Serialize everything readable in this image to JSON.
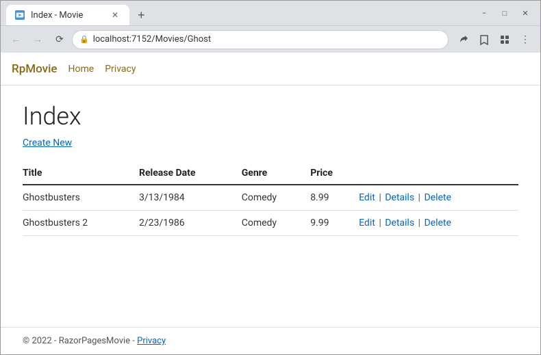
{
  "browser": {
    "tab": {
      "label": "Index - Movie",
      "favicon": "🎬"
    },
    "url": "localhost:7152/Movies/Ghost",
    "new_tab_label": "+"
  },
  "nav": {
    "brand_prefix": "Rp",
    "brand_suffix": "Movie",
    "links": [
      {
        "label": "Home",
        "href": "#"
      },
      {
        "label": "Privacy",
        "href": "#"
      }
    ]
  },
  "main": {
    "heading": "Index",
    "create_new_label": "Create New",
    "table": {
      "columns": [
        "Title",
        "Release Date",
        "Genre",
        "Price"
      ],
      "rows": [
        {
          "title": "Ghostbusters",
          "release_date": "3/13/1984",
          "genre": "Comedy",
          "price": "8.99"
        },
        {
          "title": "Ghostbusters 2",
          "release_date": "2/23/1986",
          "genre": "Comedy",
          "price": "9.99"
        }
      ],
      "actions": {
        "edit": "Edit",
        "details": "Details",
        "delete": "Delete",
        "sep": "|"
      }
    }
  },
  "footer": {
    "text": "© 2022 - RazorPagesMovie - ",
    "privacy_label": "Privacy"
  },
  "window_controls": {
    "minimize": "−",
    "maximize": "□",
    "close": "✕"
  }
}
